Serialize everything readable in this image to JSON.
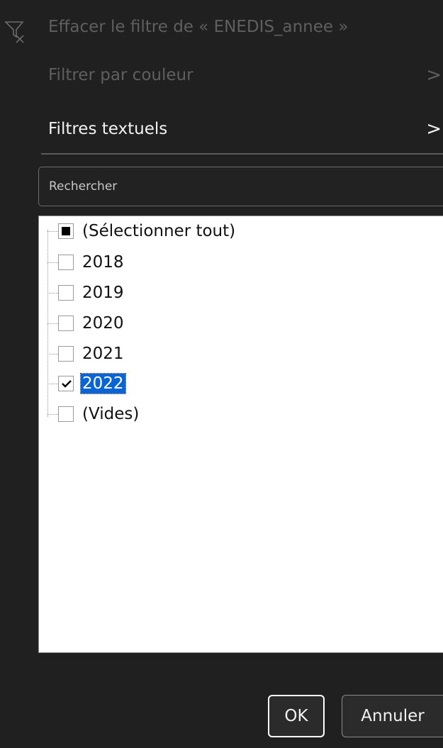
{
  "menu": {
    "clear_filter": "Effacer le filtre de « ENEDIS_annee »",
    "filter_by_color": "Filtrer par couleur",
    "text_filters": "Filtres textuels",
    "submenu_chevron": ">"
  },
  "search": {
    "placeholder": "Rechercher"
  },
  "list": {
    "items": [
      {
        "label": "(Sélectionner tout)",
        "state": "partial"
      },
      {
        "label": "2018",
        "state": "unchecked"
      },
      {
        "label": "2019",
        "state": "unchecked"
      },
      {
        "label": "2020",
        "state": "unchecked"
      },
      {
        "label": "2021",
        "state": "unchecked"
      },
      {
        "label": "2022",
        "state": "checked",
        "selected": true
      },
      {
        "label": "(Vides)",
        "state": "unchecked"
      }
    ]
  },
  "buttons": {
    "ok": "OK",
    "cancel": "Annuler"
  },
  "colors": {
    "background": "#202020",
    "selection": "#0a64d6",
    "list_bg": "#ffffff"
  }
}
